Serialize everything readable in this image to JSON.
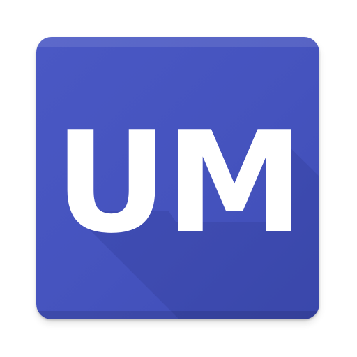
{
  "app_icon": {
    "monogram": "UM",
    "colors": {
      "tile": "#4553be",
      "tile_highlight": "#5a66cc",
      "long_shadow": "#3a469e",
      "text": "#ffffff",
      "background": "#ffffff"
    }
  }
}
